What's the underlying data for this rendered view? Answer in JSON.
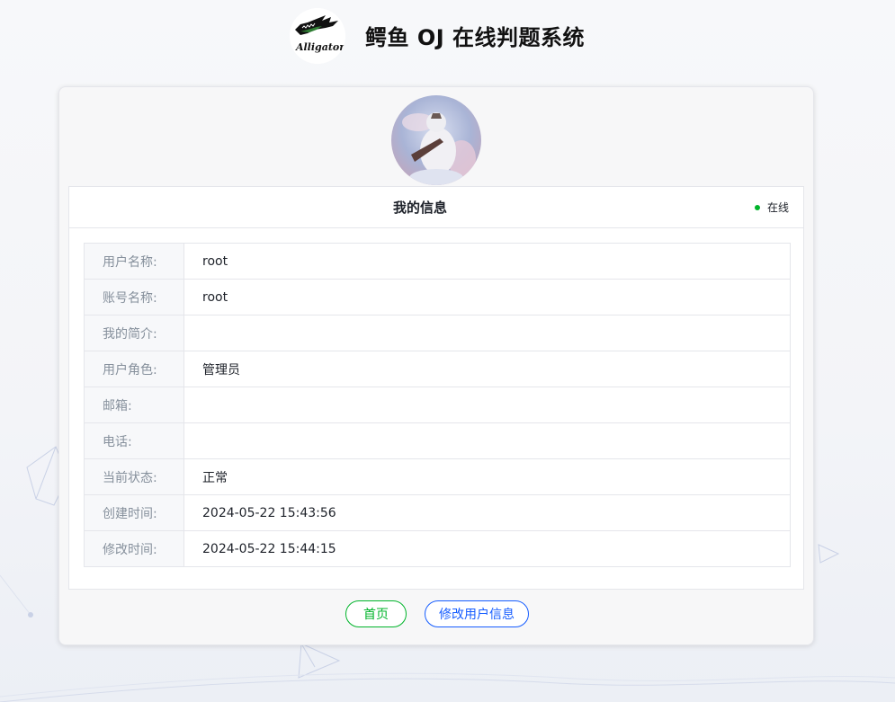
{
  "header": {
    "logo_text": "Alligator",
    "site_title": "鳄鱼 OJ 在线判题系统"
  },
  "profile": {
    "title": "我的信息",
    "status": "在线",
    "fields": [
      {
        "label": "用户名称:",
        "value": "root"
      },
      {
        "label": "账号名称:",
        "value": "root"
      },
      {
        "label": "我的简介:",
        "value": ""
      },
      {
        "label": "用户角色:",
        "value": "管理员"
      },
      {
        "label": "邮箱:",
        "value": ""
      },
      {
        "label": "电话:",
        "value": ""
      },
      {
        "label": "当前状态:",
        "value": "正常"
      },
      {
        "label": "创建时间:",
        "value": "2024-05-22 15:43:56"
      },
      {
        "label": "修改时间:",
        "value": "2024-05-22 15:44:15"
      }
    ]
  },
  "actions": {
    "home_label": "首页",
    "edit_label": "修改用户信息"
  },
  "colors": {
    "online": "#00b42a",
    "home_button": "#00b42a",
    "edit_button": "#165dff"
  }
}
